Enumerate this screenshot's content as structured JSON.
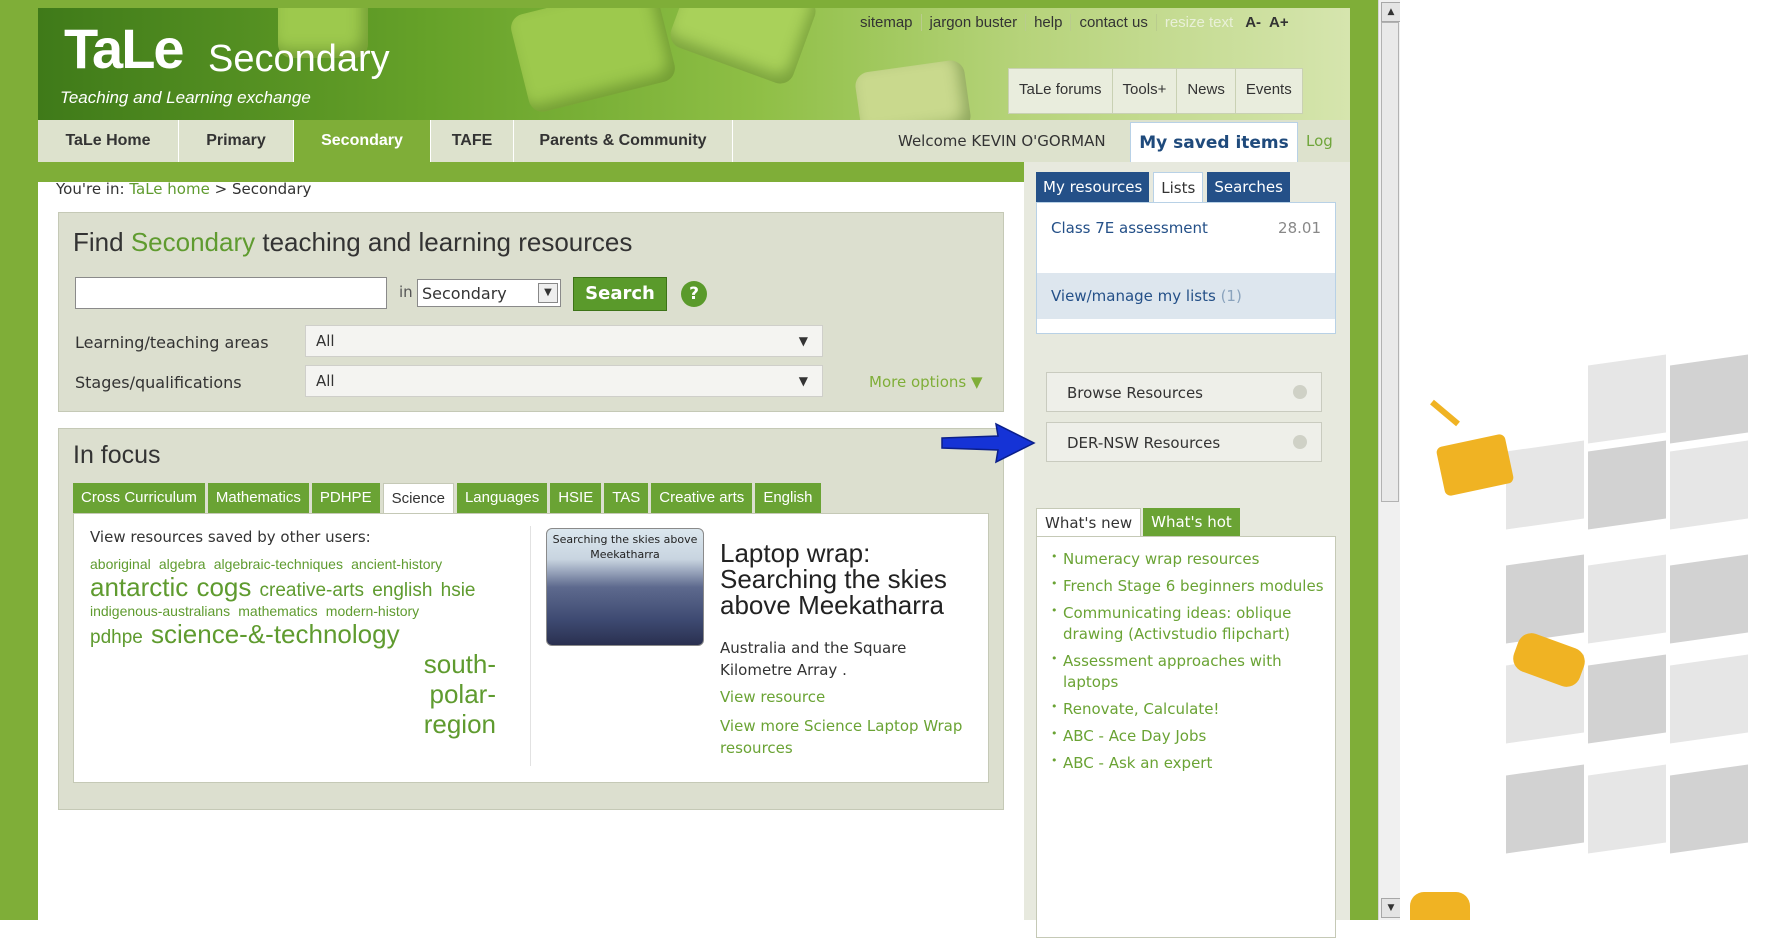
{
  "header": {
    "logo_main": "TaLe",
    "logo_sub": "Secondary",
    "tagline": "Teaching and Learning exchange",
    "util_links": [
      "sitemap",
      "jargon buster",
      "help",
      "contact us"
    ],
    "resize_label": "resize text",
    "font_smaller": "A-",
    "font_larger": "A+",
    "tool_tabs": [
      "TaLe forums",
      "Tools+",
      "News",
      "Events"
    ]
  },
  "nav": {
    "items": [
      "TaLe Home",
      "Primary",
      "Secondary",
      "TAFE",
      "Parents & Community"
    ],
    "active": "Secondary",
    "welcome": "Welcome KEVIN O'GORMAN",
    "saved_items": "My saved items",
    "logout": "Log out"
  },
  "breadcrumb": {
    "prefix": "You're in:",
    "home": "TaLe home",
    "sep": ">",
    "current": "Secondary"
  },
  "search": {
    "title_pre": "Find",
    "title_hl": "Secondary",
    "title_post": "teaching and learning resources",
    "query": "",
    "in_label": "in",
    "scope": "Secondary",
    "button": "Search",
    "help": "?",
    "filters": [
      {
        "label": "Learning/teaching areas",
        "value": "All"
      },
      {
        "label": "Stages/qualifications",
        "value": "All"
      }
    ],
    "more_options": "More options ▼"
  },
  "focus": {
    "title": "In focus",
    "tabs": [
      "Cross Curriculum",
      "Mathematics",
      "PDHPE",
      "Science",
      "Languages",
      "HSIE",
      "TAS",
      "Creative arts",
      "English"
    ],
    "active_tab": "Science",
    "cloud_intro": "View resources saved by other users:",
    "tags": [
      {
        "text": "aboriginal",
        "size": 1
      },
      {
        "text": "algebra",
        "size": 1
      },
      {
        "text": "algebraic-techniques",
        "size": 1
      },
      {
        "text": "ancient-history",
        "size": 1
      },
      {
        "text": "antarctic",
        "size": 3
      },
      {
        "text": "cogs",
        "size": 3
      },
      {
        "text": "creative-arts",
        "size": 2
      },
      {
        "text": "english",
        "size": 2
      },
      {
        "text": "hsie",
        "size": 2
      },
      {
        "text": "indigenous-australians",
        "size": 1
      },
      {
        "text": "mathematics",
        "size": 1
      },
      {
        "text": "modern-history",
        "size": 1
      },
      {
        "text": "pdhpe",
        "size": 2
      },
      {
        "text": "science-&-technology",
        "size": 3
      },
      {
        "text": "south-polar-region",
        "size": 3
      }
    ],
    "thumb_caption": "Searching the skies above Meekatharra",
    "feature_title": "Laptop wrap: Searching the skies above Meekatharra",
    "feature_desc": "Australia and the Square Kilometre Array .",
    "view_resource": "View resource",
    "view_more": "View more Science Laptop Wrap resources"
  },
  "saved": {
    "tabs": [
      "My resources",
      "Lists",
      "Searches"
    ],
    "active_tab": "Lists",
    "list_name": "Class 7E assessment",
    "list_date": "28.01",
    "manage": "View/manage my lists",
    "manage_count": "(1)"
  },
  "resources": {
    "browse": "Browse Resources",
    "der": "DER-NSW Resources"
  },
  "news": {
    "tabs": [
      "What's new",
      "What's hot"
    ],
    "active_tab": "What's new",
    "items": [
      "Numeracy wrap resources",
      "French Stage 6 beginners modules",
      "Communicating ideas: oblique drawing (Activstudio flipchart)",
      "Assessment approaches with laptops",
      "Renovate, Calculate!",
      "ABC - Ace Day Jobs",
      "ABC - Ask an expert"
    ]
  },
  "colors": {
    "brand_green": "#7fae38",
    "accent_green": "#5a9a2b",
    "blue": "#245088",
    "arrow_blue": "#1533d6"
  }
}
